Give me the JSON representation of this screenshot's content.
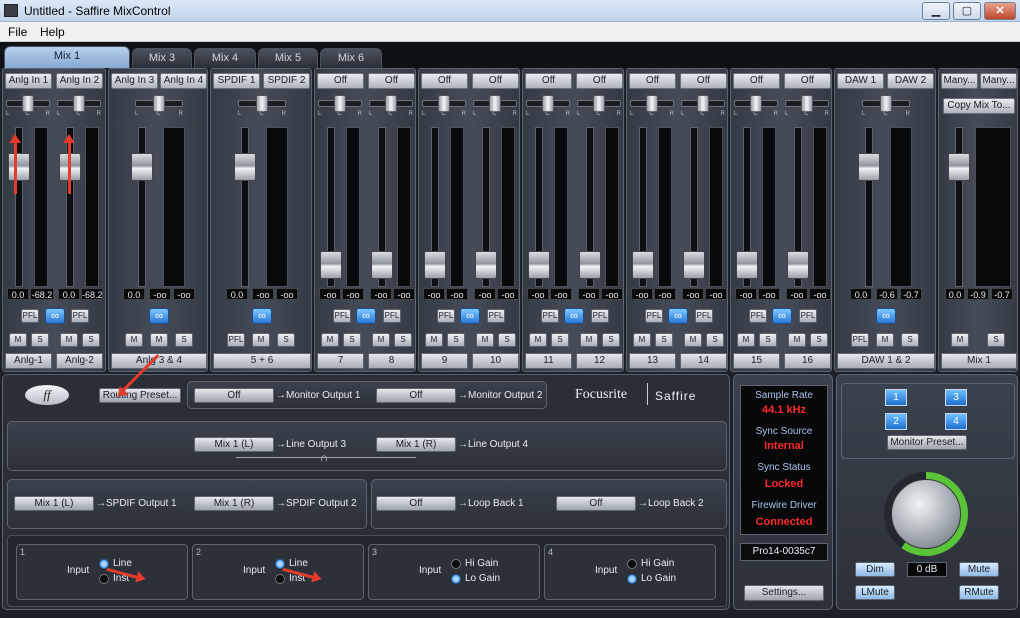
{
  "window": {
    "title": "Untitled - Saffire MixControl",
    "minimize": "▁",
    "maximize": "▢",
    "close": "✕"
  },
  "menu": [
    "File",
    "Help"
  ],
  "tabs": [
    "Mix 1",
    "Mix 3",
    "Mix 4",
    "Mix 5",
    "Mix 6"
  ],
  "strips": [
    {
      "inputs": [
        "Anlg In 1",
        "Anlg In 2"
      ],
      "values": [
        "0.0",
        "-68.2"
      ],
      "names": [
        "Anlg-1",
        "Anlg-2"
      ]
    },
    {
      "inputs": [
        "Anlg In 3",
        "Anlg In 4"
      ],
      "values": [
        "0.0",
        "-oo",
        "-oo"
      ],
      "names": [
        "Anlg 3 & 4"
      ]
    },
    {
      "inputs": [
        "SPDIF 1",
        "SPDIF 2"
      ],
      "values": [
        "0.0",
        "-oo",
        "-oo"
      ],
      "names": [
        "5 + 6"
      ]
    },
    {
      "pairs": [
        {
          "inputs": [
            "Off",
            "Off"
          ],
          "values": [
            "-oo",
            "-oo",
            "-oo",
            "-oo"
          ],
          "names": [
            "7",
            "8"
          ]
        },
        {
          "inputs": [
            "Off",
            "Off"
          ],
          "values": [
            "-oo",
            "-oo",
            "-oo",
            "-oo"
          ],
          "names": [
            "9",
            "10"
          ]
        },
        {
          "inputs": [
            "Off",
            "Off"
          ],
          "values": [
            "-oo",
            "-oo",
            "-oo",
            "-oo"
          ],
          "names": [
            "11",
            "12"
          ]
        },
        {
          "inputs": [
            "Off",
            "Off"
          ],
          "values": [
            "-oo",
            "-oo",
            "-oo",
            "-oo"
          ],
          "names": [
            "13",
            "14"
          ]
        },
        {
          "inputs": [
            "Off",
            "Off"
          ],
          "values": [
            "-oo",
            "-oo",
            "-oo",
            "-oo"
          ],
          "names": [
            "15",
            "16"
          ]
        }
      ]
    },
    {
      "inputs": [
        "DAW 1",
        "DAW 2"
      ],
      "values": [
        "0.0",
        "-0.6",
        "-0.7"
      ],
      "names": [
        "DAW 1 & 2"
      ]
    },
    {
      "inputs": [
        "Many...",
        "Many..."
      ],
      "copy": "Copy Mix To...",
      "values": [
        "0.0",
        "-0.9",
        "-0.7"
      ],
      "names": [
        "Mix 1"
      ]
    }
  ],
  "button_labels": {
    "pfl": "PFL",
    "m": "M",
    "s": "S",
    "link": "∞"
  },
  "routing": {
    "preset": "Routing Preset...",
    "monitor1": {
      "src": "Off",
      "dst": "→Monitor Output 1"
    },
    "monitor2": {
      "src": "Off",
      "dst": "→Monitor Output 2"
    },
    "line3": {
      "src": "Mix 1 (L)",
      "dst": "→Line Output 3"
    },
    "line4": {
      "src": "Mix 1 (R)",
      "dst": "→Line Output 4"
    },
    "spdif1": {
      "src": "Mix 1 (L)",
      "dst": "→SPDIF Output 1"
    },
    "spdif2": {
      "src": "Mix 1 (R)",
      "dst": "→SPDIF Output 2"
    },
    "loop1": {
      "src": "Off",
      "dst": "→Loop Back 1"
    },
    "loop2": {
      "src": "Off",
      "dst": "→Loop Back 2"
    },
    "logo_brand": "Focusrite",
    "logo_product": "Saffire"
  },
  "inputs_section": [
    {
      "num": "1",
      "label": "Input",
      "opt1": "Line",
      "opt2": "Inst",
      "selected": 1
    },
    {
      "num": "2",
      "label": "Input",
      "opt1": "Line",
      "opt2": "Inst",
      "selected": 1
    },
    {
      "num": "3",
      "label": "Input",
      "opt1": "Hi Gain",
      "opt2": "Lo Gain",
      "selected": 2
    },
    {
      "num": "4",
      "label": "Input",
      "opt1": "Hi Gain",
      "opt2": "Lo Gain",
      "selected": 2
    }
  ],
  "status": {
    "sample_rate_label": "Sample Rate",
    "sample_rate": "44.1 kHz",
    "sync_source_label": "Sync Source",
    "sync_source": "Internal",
    "sync_status_label": "Sync Status",
    "sync_status": "Locked",
    "driver_label": "Firewire Driver",
    "driver": "Connected",
    "device": "Pro14-0035c7",
    "settings": "Settings..."
  },
  "monitor": {
    "buttons": [
      "1",
      "3",
      "2",
      "4"
    ],
    "preset": "Monitor Preset...",
    "dim": "Dim",
    "level": "0 dB",
    "mute": "Mute",
    "lmute": "LMute",
    "rmute": "RMute"
  }
}
